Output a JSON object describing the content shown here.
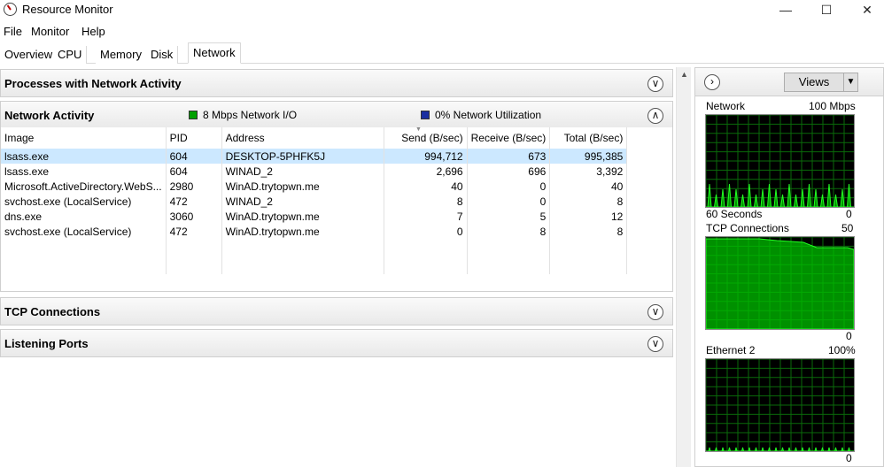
{
  "window": {
    "title": "Resource Monitor",
    "minimize_icon": "minimize-icon",
    "maximize_icon": "maximize-icon",
    "close_icon": "close-icon"
  },
  "menu": [
    "File",
    "Monitor",
    "Help"
  ],
  "tabs": [
    "Overview",
    "CPU",
    "Memory",
    "Disk",
    "Network"
  ],
  "active_tab": "Network",
  "sections": {
    "processes": "Processes with Network Activity",
    "network_activity": "Network Activity",
    "tcp": "TCP Connections",
    "listening": "Listening Ports"
  },
  "network_activity": {
    "io_label": "8 Mbps Network I/O",
    "io_color": "#00a000",
    "util_label": "0% Network Utilization",
    "util_color": "#1a2ea0",
    "columns": [
      "Image",
      "PID",
      "Address",
      "Send (B/sec)",
      "Receive (B/sec)",
      "Total (B/sec)"
    ],
    "rows": [
      [
        "lsass.exe",
        "604",
        "DESKTOP-5PHFK5J",
        "994,712",
        "673",
        "995,385"
      ],
      [
        "lsass.exe",
        "604",
        "WINAD_2",
        "2,696",
        "696",
        "3,392"
      ],
      [
        "Microsoft.ActiveDirectory.WebS...",
        "2980",
        "WinAD.trytopwn.me",
        "40",
        "0",
        "40"
      ],
      [
        "svchost.exe (LocalService)",
        "472",
        "WINAD_2",
        "8",
        "0",
        "8"
      ],
      [
        "dns.exe",
        "3060",
        "WinAD.trytopwn.me",
        "7",
        "5",
        "12"
      ],
      [
        "svchost.exe (LocalService)",
        "472",
        "WinAD.trytopwn.me",
        "0",
        "8",
        "8"
      ]
    ]
  },
  "right_panel": {
    "views_label": "Views",
    "graphs": {
      "network": {
        "title": "Network",
        "max": "100 Mbps",
        "bottom_left": "60 Seconds",
        "bottom_right": "0"
      },
      "tcp": {
        "title": "TCP Connections",
        "max": "50",
        "bottom_right": "0"
      },
      "ethernet": {
        "title": "Ethernet 2",
        "max": "100%",
        "bottom_right": "0"
      }
    },
    "graph_color": "#00c000"
  }
}
